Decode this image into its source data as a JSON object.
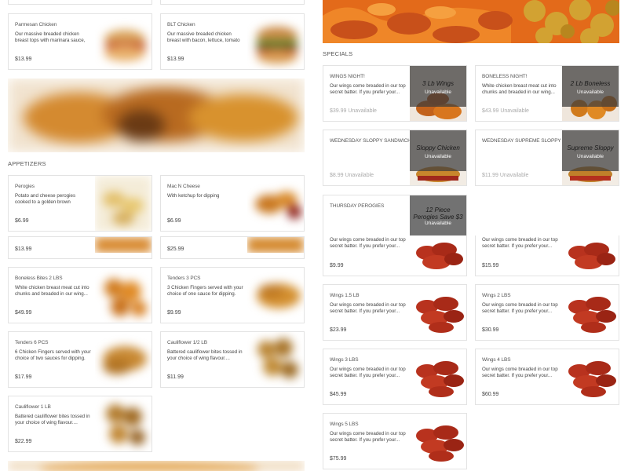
{
  "left": {
    "top_cards": [
      {
        "name": "Parmesan Chicken",
        "desc": "Our massive breaded chicken breast tops with marinara sauce, cheese,...",
        "price": "$13.99"
      },
      {
        "name": "BLT Chicken",
        "desc": "Our massive breaded chicken breast with bacon, lettuce, tomato and...",
        "price": "$13.99"
      }
    ],
    "appetizers_title": "APPETIZERS",
    "appetizers": [
      {
        "name": "Perogies",
        "desc": "Potato and cheese perogies cooked to a golden brown perfection serv...",
        "price": "$6.99"
      },
      {
        "name": "Mac N Cheese",
        "desc": "With ketchup for dipping",
        "price": "$6.99"
      },
      {
        "name": "",
        "desc": "",
        "price": "$13.99"
      },
      {
        "name": "",
        "desc": "",
        "price": "$25.99"
      },
      {
        "name": "Boneless Bites 2 LBS",
        "desc": "White chicken breast meat cut into chunks and breaded in our wing...",
        "price": "$49.99"
      },
      {
        "name": "Tenders 3 PCS",
        "desc": "3 Chicken Fingers served with your choice of one sauce for dipping.",
        "price": "$9.99"
      },
      {
        "name": "Tenders 6 PCS",
        "desc": "6 Chicken Fingers served with your choice of two sauces for dipping.",
        "price": "$17.99"
      },
      {
        "name": "Cauliflower 1/2 LB",
        "desc": "Battered cauliflower bites tossed in your choice of wing flavour....",
        "price": "$11.99"
      },
      {
        "name": "Cauliflower 1 LB",
        "desc": "Battered cauliflower bites tossed in your choice of wing flavour....",
        "price": "$22.99"
      }
    ]
  },
  "right": {
    "specials_title": "SPECIALS",
    "specials": [
      {
        "name": "WINGS NIGHT!",
        "desc": "Our wings come breaded in our top secret batter. If you prefer your...",
        "price": "$39.99 Unavailable",
        "overlay_title": "3 Lb Wings",
        "overlay_status": "Unavailable"
      },
      {
        "name": "BONELESS NIGHT!",
        "desc": "White chicken breast meat cut into chunks and breaded in our wing...",
        "price": "$43.99 Unavailable",
        "overlay_title": "2 Lb Boneless",
        "overlay_status": "Unavailable"
      },
      {
        "name": "WEDNESDAY SLOPPY SANDWICH",
        "desc": "",
        "price": "$8.99 Unavailable",
        "overlay_title": "Sloppy Chicken",
        "overlay_status": "Unavailable"
      },
      {
        "name": "WEDNESDAY SUPREME SLOPPY",
        "desc": "",
        "price": "$11.99 Unavailable",
        "overlay_title": "Supreme Sloppy",
        "overlay_status": "Unavailable"
      },
      {
        "name": "THURSDAY PEROGIES",
        "desc": "",
        "price": "",
        "overlay_title": "12 Piece Perogies Save $3",
        "overlay_status": "Unavailable"
      }
    ],
    "wings": [
      {
        "name": "",
        "desc": "Our wings come breaded in our top secret batter. If you prefer your...",
        "price": "$9.99"
      },
      {
        "name": "",
        "desc": "Our wings come breaded in our top secret batter. If you prefer your...",
        "price": "$15.99"
      },
      {
        "name": "Wings 1.5 LB",
        "desc": "Our wings come breaded in our top secret batter. If you prefer your...",
        "price": "$23.99"
      },
      {
        "name": "Wings 2 LBS",
        "desc": "Our wings come breaded in our top secret batter. If you prefer your...",
        "price": "$30.99"
      },
      {
        "name": "Wings 3 LBS",
        "desc": "Our wings come breaded in our top secret batter. If you prefer your...",
        "price": "$45.99"
      },
      {
        "name": "Wings 4 LBS",
        "desc": "Our wings come breaded in our top secret batter. If you prefer your...",
        "price": "$60.99"
      },
      {
        "name": "Wings 5 LBS",
        "desc": "Our wings come breaded in our top secret batter. If you prefer your...",
        "price": "$75.99"
      }
    ]
  },
  "colors": {
    "border": "#e3e3e3",
    "text": "#444444",
    "muted": "#aaaaaa",
    "wing_red": "#b8321e",
    "fried_orange": "#e08a2a"
  }
}
